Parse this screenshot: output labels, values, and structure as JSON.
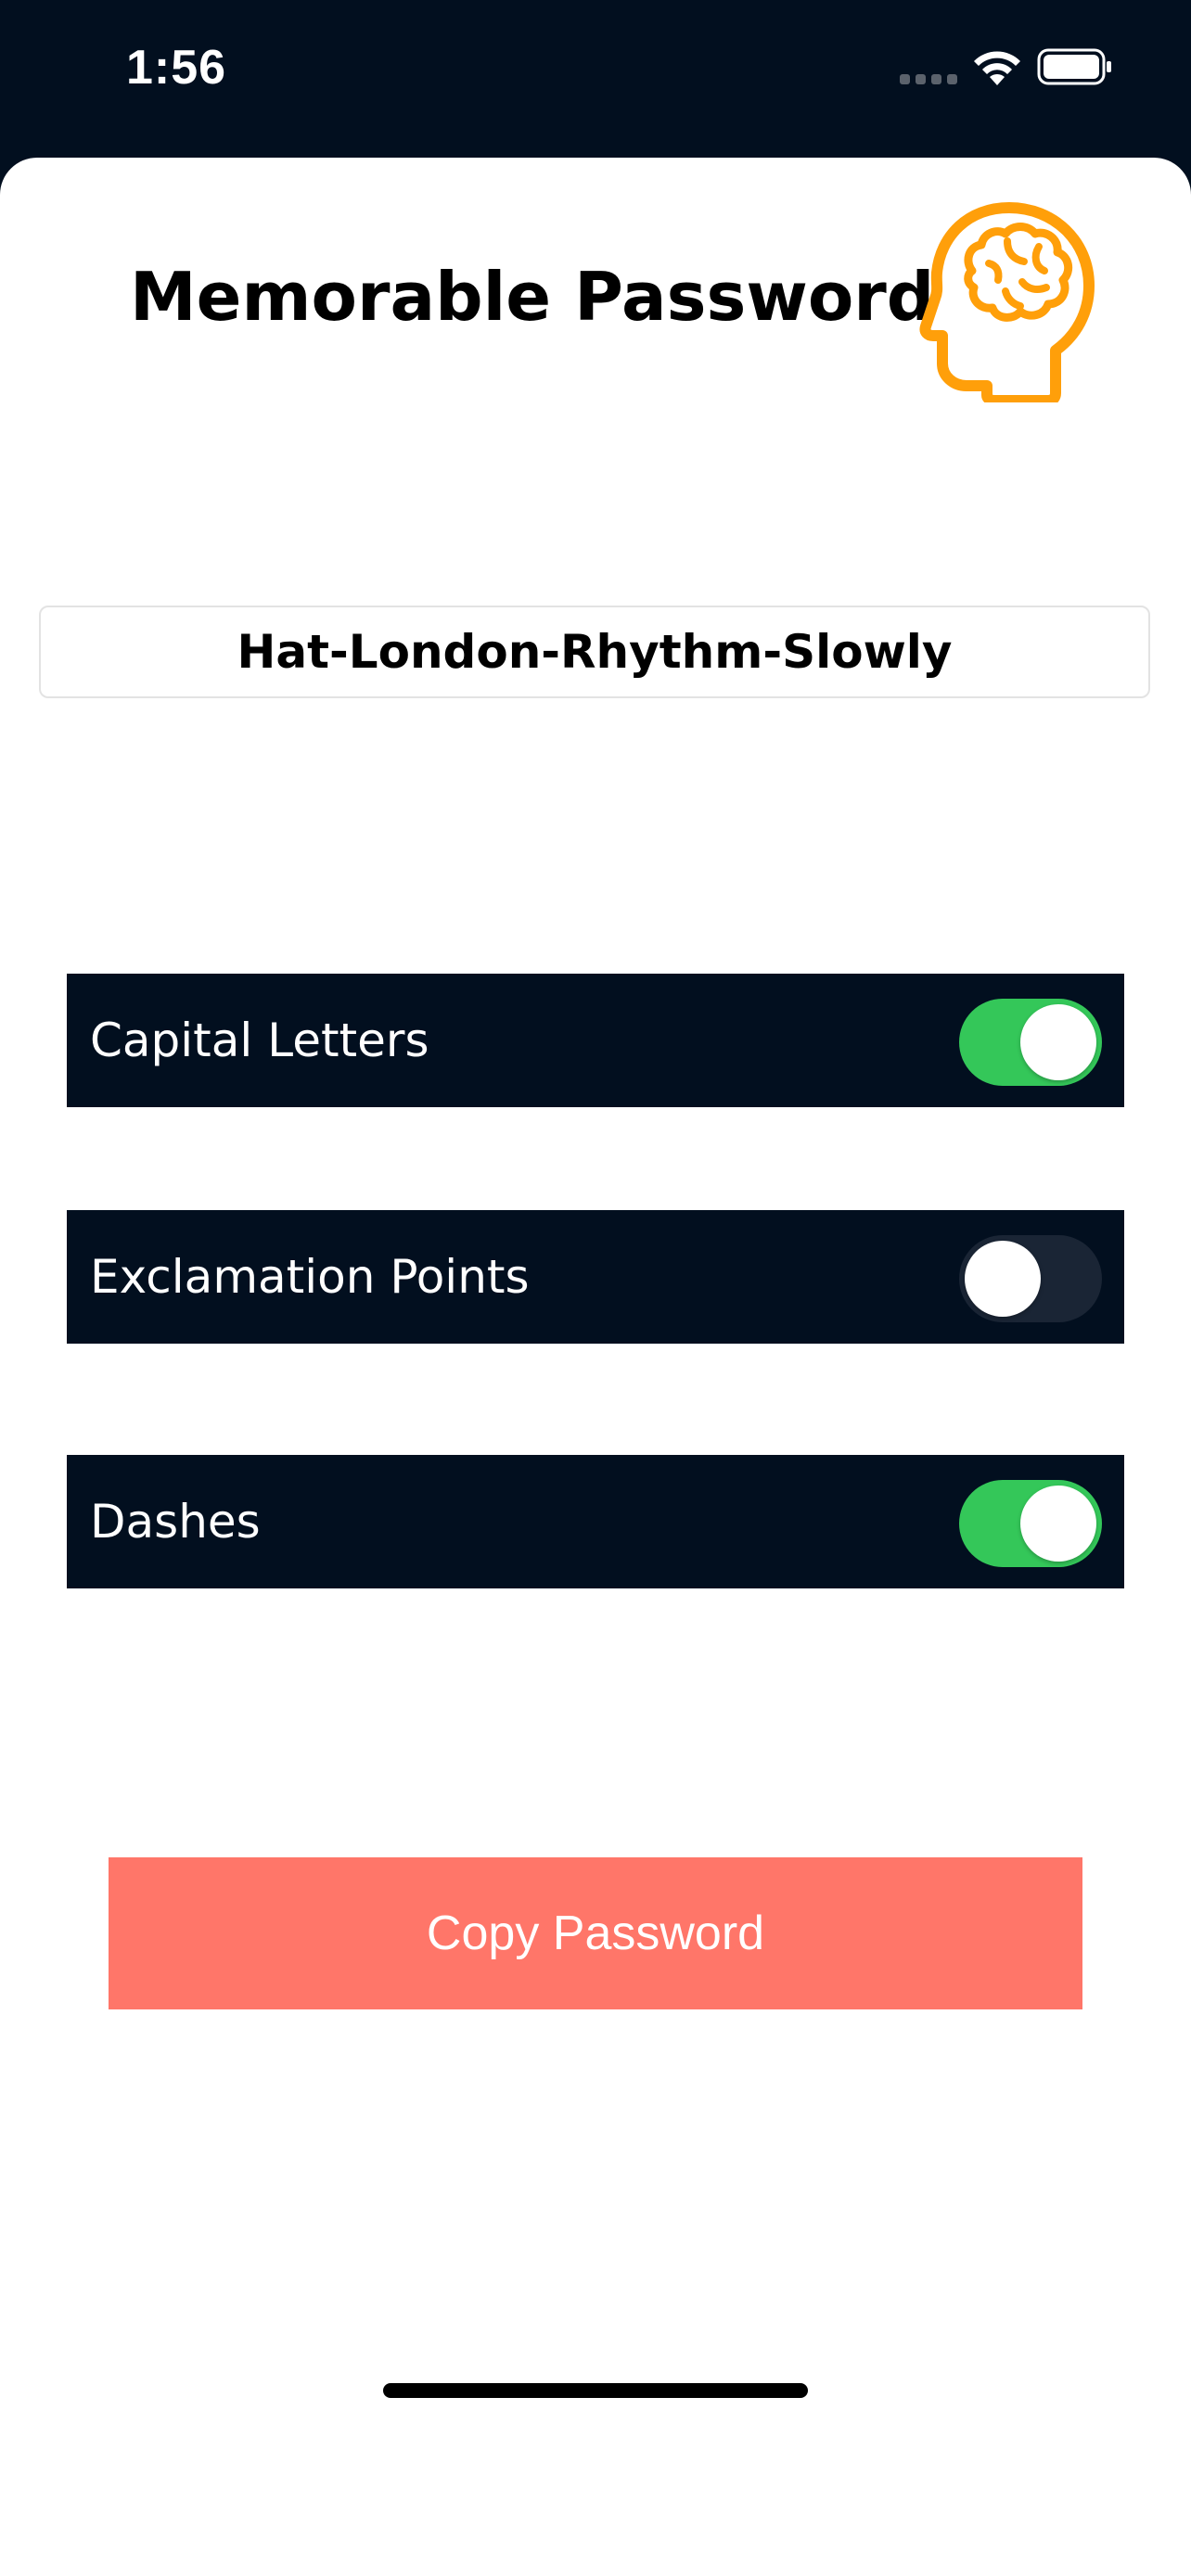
{
  "status_bar": {
    "time": "1:56"
  },
  "app": {
    "title": "Memorable Password",
    "title_icon": "brain-head-icon",
    "accent_color": "#ff9f0a"
  },
  "password": {
    "value": "Hat-London-Rhythm-Slowly"
  },
  "options": [
    {
      "label": "Capital Letters",
      "enabled": true
    },
    {
      "label": "Exclamation Points",
      "enabled": false
    },
    {
      "label": "Dashes",
      "enabled": true
    }
  ],
  "copy_button": {
    "label": "Copy Password",
    "color": "#ff7669"
  },
  "colors": {
    "navy": "#020f1f",
    "toggle_on": "#34c759"
  }
}
